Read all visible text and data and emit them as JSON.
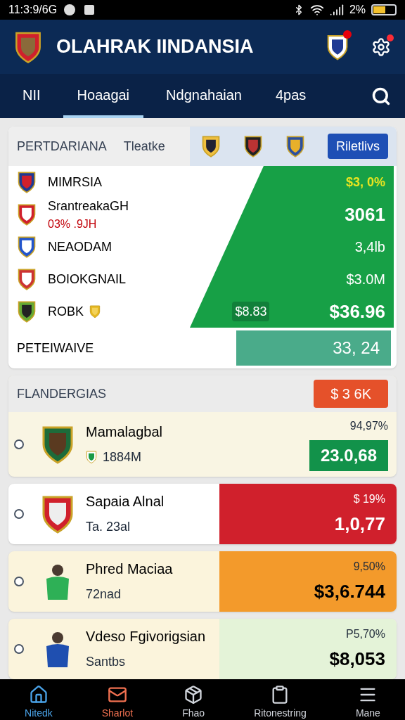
{
  "status_bar": {
    "time": "11:3:9/6G",
    "battery_text": "2%"
  },
  "header": {
    "title": "OLAHRAK IINDANSIA",
    "notification": true,
    "settings_dot": true
  },
  "tabs": [
    {
      "label": "NII",
      "selected": false
    },
    {
      "label": "Hoaagai",
      "selected": true
    },
    {
      "label": "Ndgnahaian",
      "selected": false
    },
    {
      "label": "4pas",
      "selected": false
    }
  ],
  "standings": {
    "title": "PERTDARIANA",
    "subtitle": "Tleatke",
    "button": "Riletlivs",
    "rows": [
      {
        "name": "MIMRSIA",
        "value": "$3, 0%",
        "highlight": true
      },
      {
        "name": "SrantreakaGH",
        "sub": "03% .9JH",
        "value": "3061",
        "highlight": false
      },
      {
        "name": "NEAODAM",
        "value": "3,4lb",
        "highlight": false
      },
      {
        "name": "BOIOKGNAIL",
        "value": "$3.0M",
        "highlight": false
      },
      {
        "name": "ROBK",
        "chip": "$8.83",
        "value": "$36.96",
        "highlight": false
      }
    ],
    "footer": {
      "label": "PETEIWAIVE",
      "value": "33, 24"
    }
  },
  "featured": {
    "title": "FLANDERGIAS",
    "badge": "$ 3 6K",
    "item": {
      "name": "Mamalagbal",
      "sub": "1884M",
      "percent": "94,97%",
      "value": "23.0,68",
      "selected": false
    }
  },
  "items": [
    {
      "kind": "crest",
      "name": "Sapaia Alnal",
      "sub": "Ta. 23al",
      "percent": "$ 19%",
      "value": "1,0,77",
      "color": "#d0202c",
      "selected": false
    },
    {
      "kind": "player",
      "name": "Phred Maciaa",
      "sub": "72nad",
      "percent": "9,50%",
      "value": "$3,6.744",
      "color": "#f39a2b",
      "selected": false
    },
    {
      "kind": "player",
      "name": "Vdeso Fgivorigsian",
      "sub": "Santbs",
      "percent": "P5,70%",
      "value": "$8,053",
      "color": "#e4f3d8",
      "selected": false
    }
  ],
  "bottom_nav": [
    {
      "label": "Nitedk",
      "selected": true
    },
    {
      "label": "Sharlot",
      "selected": false
    },
    {
      "label": "Fhao",
      "selected": false
    },
    {
      "label": "Ritonestring",
      "selected": false
    },
    {
      "label": "Mane",
      "selected": false
    }
  ]
}
